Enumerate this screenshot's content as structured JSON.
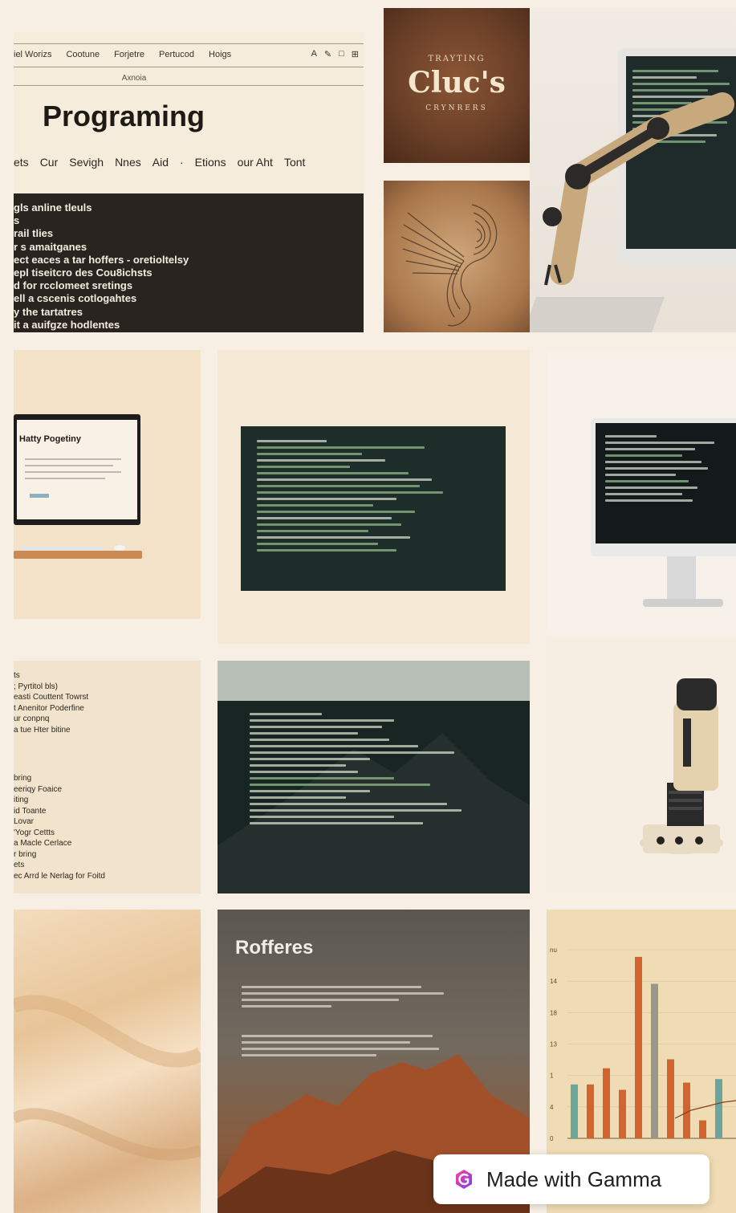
{
  "top_left": {
    "nav_items": [
      "iel Worizs",
      "Cootune",
      "Forjetre",
      "Pertucod",
      "Hoigs"
    ],
    "toolbar_icons": [
      "font-a-icon",
      "pencil-icon",
      "square-icon",
      "grid-icon"
    ],
    "nav_sub": "Axnoia",
    "title": "Programing",
    "menu_items": [
      "ets",
      "Cur",
      "Sevigh",
      "Nnes",
      "Aid",
      "·",
      "Etions",
      "our Aht",
      "Tont"
    ],
    "dark_lines": [
      "gls anline tleuls",
      "s",
      "rail tlies",
      "r s amaitganes",
      "ect eaces a tar hoffers - oretioltelsy",
      "epl tiseitcro des Cou8ichsts",
      "d for rcclomeet sretings",
      "ell a cscenis cotlogahtes",
      "y the tartatres",
      "it a auifgze hodlentes"
    ]
  },
  "book_cover": {
    "subtitle": "TRAYTING",
    "title": "Cluc's",
    "tagline": "CRYNRERS"
  },
  "monitor_small": {
    "title": "Hatty Pogetiny"
  },
  "text_list": {
    "group_a": [
      "ts",
      "; Pyrtitol bls)",
      "easti Couttent Towrst",
      "t Anenitor Poderfine",
      "ur conpnq",
      "a tue Hter bitine"
    ],
    "group_b": [
      "bring",
      "eeriqy Foaice",
      "iting",
      "id Toante",
      "Lovar",
      "'Yogr Cettts",
      "a Macle Cerlace",
      "r bring",
      "ets",
      "ec Arrd le Nerlag for Foitd"
    ]
  },
  "rofferes": {
    "title": "Rofferes"
  },
  "branding": {
    "badge_label": "Made with Gamma",
    "badge_icon": "gamma-logo-icon"
  },
  "chart_data": {
    "type": "bar",
    "y_ticks": [
      "nu",
      "14",
      "18",
      "13",
      "1",
      "4",
      "0"
    ],
    "bar_values": [
      3,
      3,
      3.9,
      2.7,
      10.1,
      8.6,
      4.4,
      3.1,
      1.0,
      3.3
    ]
  },
  "colors": {
    "background": "#f7efe3",
    "dark_panel": "#2a2420",
    "code_panel": "#1e2d29",
    "leather": "#6b4028",
    "bar_orange": "#d2642f",
    "bar_teal": "#6aa79a",
    "bar_gray": "#9b968a"
  }
}
